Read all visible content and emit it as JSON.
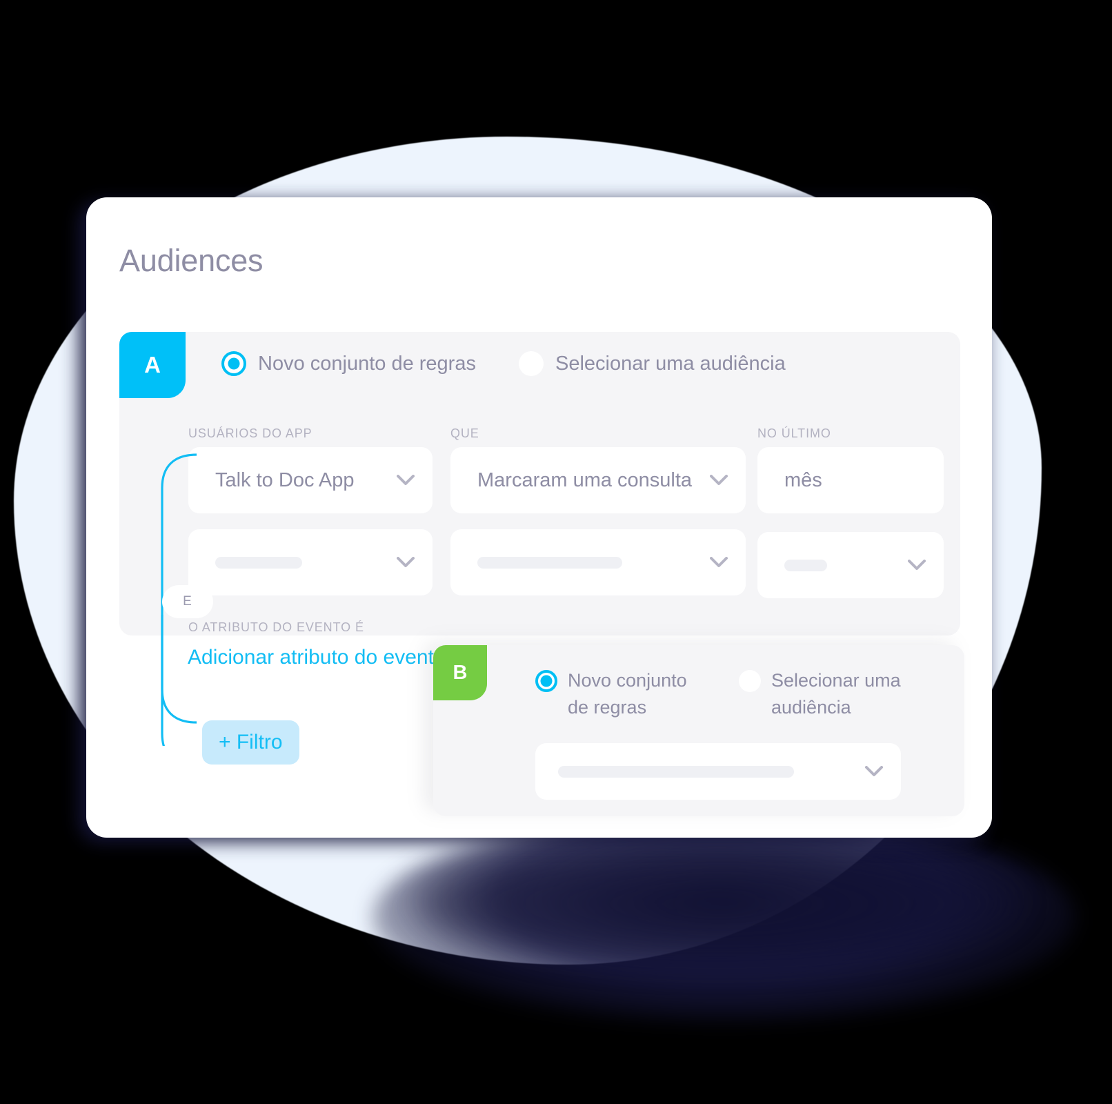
{
  "page": {
    "title": "Audiences"
  },
  "group_a": {
    "badge": "A",
    "options": [
      {
        "label": "Novo conjunto de regras",
        "selected": true
      },
      {
        "label": "Selecionar uma audiência",
        "selected": false
      }
    ],
    "columns": [
      {
        "label": "USUÁRIOS DO APP"
      },
      {
        "label": "QUE"
      },
      {
        "label": "NO ÚLTIMO"
      }
    ],
    "row1": [
      {
        "value": "Talk to Doc App",
        "has_chevron": true
      },
      {
        "value": "Marcaram uma consulta",
        "has_chevron": true
      },
      {
        "value": "mês",
        "has_chevron": false
      }
    ],
    "row2": [
      {
        "value": "",
        "placeholder_width": 126,
        "has_chevron": true
      },
      {
        "value": "",
        "placeholder_width": 210,
        "has_chevron": true
      },
      {
        "value": "",
        "placeholder_width": 62,
        "has_chevron": true
      }
    ],
    "connector_label": "E",
    "attribute_label": "O ATRIBUTO DO EVENTO É",
    "attribute_link": "Adicionar atributo do evento",
    "filter_button": "+ Filtro"
  },
  "group_b": {
    "badge": "B",
    "options": [
      {
        "label": "Novo conjunto de regras",
        "selected": true
      },
      {
        "label": "Selecionar uma audiência",
        "selected": false
      }
    ],
    "select": {
      "value": "",
      "placeholder_width": 342,
      "has_chevron": true
    }
  },
  "icons": {
    "chevron_down": "chevron-down-icon",
    "radio_selected": "radio-selected-icon",
    "radio_unselected": "radio-unselected-icon",
    "plus": "plus-icon"
  },
  "colors": {
    "accent_cyan": "#00c0f8",
    "accent_green": "#75cc43",
    "link_blue": "#12bdf4",
    "text_muted": "#8e8da4",
    "label_muted": "#b3b2c1",
    "panel_bg": "#f5f5f7",
    "card_bg": "#ffffff",
    "page_blob": "#edf4fd"
  }
}
